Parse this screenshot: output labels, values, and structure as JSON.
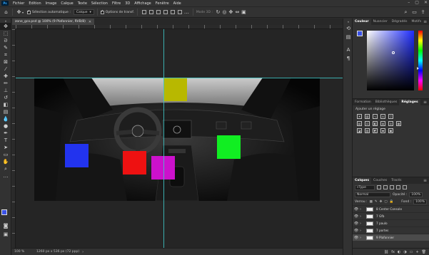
{
  "menubar": {
    "logo": "Ps",
    "items": [
      "Fichier",
      "Edition",
      "Image",
      "Calque",
      "Texte",
      "Sélection",
      "Filtre",
      "3D",
      "Affichage",
      "Fenêtre",
      "Aide"
    ]
  },
  "options": {
    "auto_select_label": "Sélection automatique :",
    "auto_select_value": "Calque",
    "transform_label": "Options de transf.",
    "mode3d_label": "Mode 3D :"
  },
  "document": {
    "tab_title": "zone_gco.psd @ 100% (9 Plafonnier, RVB/8)",
    "rects": [
      {
        "name": "olive",
        "color": "#b8b800"
      },
      {
        "name": "blue",
        "color": "#2233ee"
      },
      {
        "name": "red",
        "color": "#ee1111"
      },
      {
        "name": "magenta",
        "color": "#cc11cc"
      },
      {
        "name": "green",
        "color": "#11ee22"
      }
    ]
  },
  "status": {
    "zoom": "100 %",
    "info": "1260 px x 536 px (72 ppp)",
    "arrow": "›"
  },
  "panels": {
    "color_tabs": [
      "Couleur",
      "Nuancier",
      "Dégradés",
      "Motifs"
    ],
    "adjust_tabs": [
      "Formation",
      "Bibliothèques",
      "Réglages"
    ],
    "adjust_title": "Ajouter un réglage",
    "layers_tabs": [
      "Calques",
      "Couches",
      "Tracés"
    ],
    "filter_value": "Type",
    "blend_mode": "Normal",
    "opacity_label": "Opacité :",
    "opacity_value": "100%",
    "lock_label": "Verrou :",
    "fill_label": "Fond :",
    "fill_value": "100%",
    "layers": [
      {
        "name": "8 Center Console",
        "selected": false
      },
      {
        "name": "7 Gfb",
        "selected": false
      },
      {
        "name": "7 paulo",
        "selected": false
      },
      {
        "name": "7 portes",
        "selected": false
      },
      {
        "name": "9 Plafonnier",
        "selected": true
      }
    ]
  },
  "colors": {
    "foreground": "#3a52e8",
    "background": "#ffffff",
    "guide": "#3fc7c7",
    "app_bg": "#323232"
  }
}
